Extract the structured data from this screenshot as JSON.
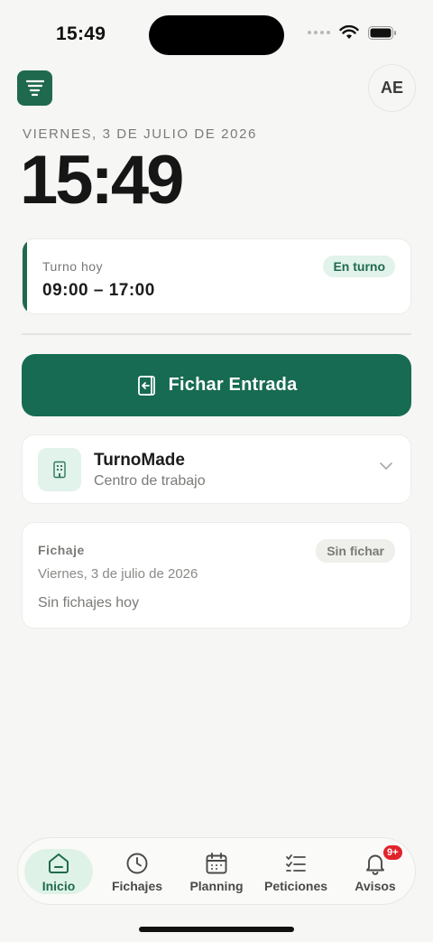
{
  "status_bar": {
    "time": "15:49"
  },
  "header": {
    "avatar_initials": "AE"
  },
  "date_label": "VIERNES, 3 DE JULIO DE 2026",
  "clock": "15:49",
  "shift": {
    "label": "Turno hoy",
    "hours": "09:00 – 17:00",
    "status": "En turno"
  },
  "clock_in": {
    "label": "Fichar Entrada"
  },
  "workplace": {
    "name": "TurnoMade",
    "subtitle": "Centro de trabajo"
  },
  "record": {
    "title": "Fichaje",
    "status": "Sin fichar",
    "date": "Viernes, 3 de julio de 2026",
    "empty": "Sin fichajes hoy"
  },
  "tabs": [
    {
      "label": "Inicio",
      "icon": "home-icon",
      "active": true
    },
    {
      "label": "Fichajes",
      "icon": "clock-icon"
    },
    {
      "label": "Planning",
      "icon": "calendar-icon"
    },
    {
      "label": "Peticiones",
      "icon": "checklist-icon"
    },
    {
      "label": "Avisos",
      "icon": "bell-icon",
      "badge": "9+"
    }
  ],
  "colors": {
    "brand": "#1f6a4e",
    "accent_light": "#e1f3ea",
    "badge_red": "#e0242b"
  }
}
